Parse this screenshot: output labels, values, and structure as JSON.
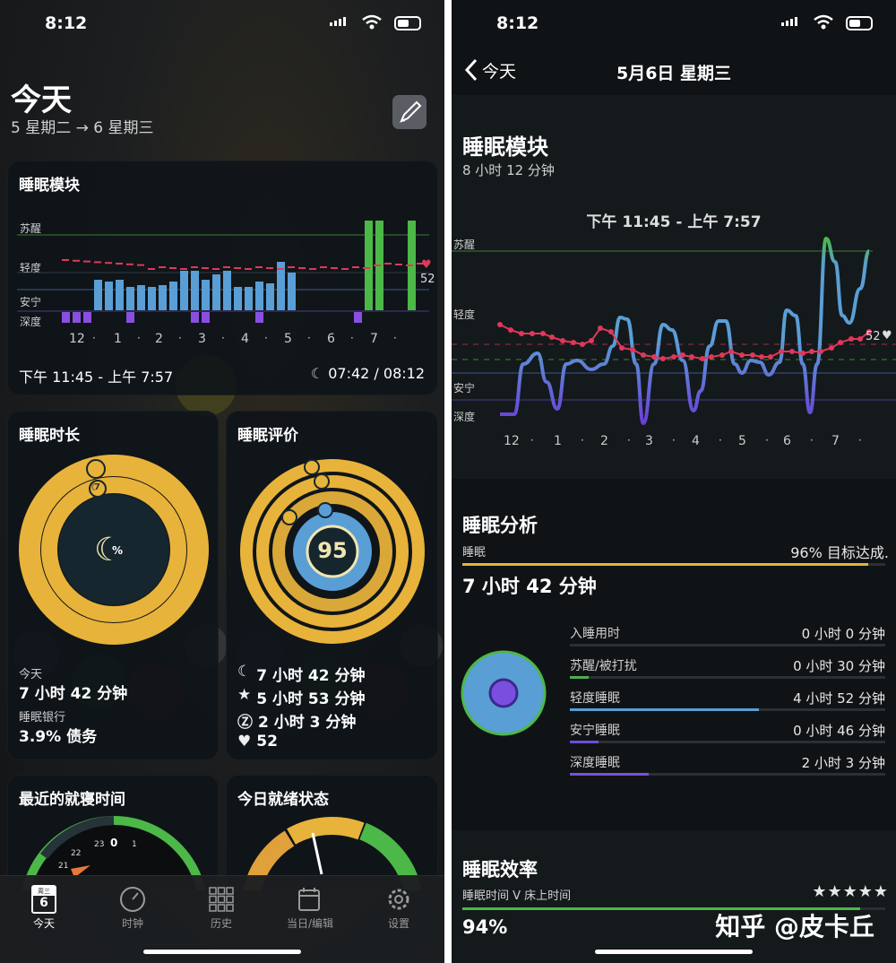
{
  "status": {
    "time": "8:12"
  },
  "left": {
    "title": "今天",
    "subtitle": "5 星期二 → 6 星期三",
    "sleep_module": {
      "title": "睡眠模块",
      "stage_labels": [
        "苏醒",
        "轻度",
        "安宁",
        "深度"
      ],
      "hour_labels": [
        "12",
        "1",
        "2",
        "3",
        "4",
        "5",
        "6",
        "7"
      ],
      "heart_value": "52",
      "time_range": "下午 11:45 - 上午 7:57",
      "duration_ratio": "07:42 / 08:12"
    },
    "duration_card": {
      "title": "睡眠时长",
      "ring_badge": "7",
      "center_label": "%",
      "today_label": "今天",
      "today_value": "7 小时 42 分钟",
      "bank_label": "睡眠银行",
      "bank_value": "3.9% 债务"
    },
    "rating_card": {
      "title": "睡眠评价",
      "score": "95",
      "rows": [
        "7 小时 42 分钟",
        "5 小时 53 分钟",
        "2 小时 3 分钟",
        "52"
      ]
    },
    "bedtime_card": {
      "title": "最近的就寝时间",
      "dial_numbers": [
        "23",
        "0",
        "1",
        "22",
        "21"
      ]
    },
    "readiness_card": {
      "title": "今日就绪状态"
    },
    "tabs": [
      {
        "label": "今天",
        "badge_top": "周三",
        "badge_num": "6"
      },
      {
        "label": "时钟"
      },
      {
        "label": "历史"
      },
      {
        "label": "当日/编辑"
      },
      {
        "label": "设置"
      }
    ]
  },
  "right": {
    "nav": {
      "back_label": "今天",
      "title": "5月6日 星期三"
    },
    "sleep_module": {
      "title": "睡眠模块",
      "subtitle": "8 小时 12 分钟",
      "chart_title": "下午 11:45 - 上午 7:57",
      "stage_labels": [
        "苏醒",
        "轻度",
        "安宁",
        "深度"
      ],
      "hour_labels": [
        "12",
        "1",
        "2",
        "3",
        "4",
        "5",
        "6",
        "7"
      ],
      "heart_value": "52"
    },
    "analysis": {
      "title": "睡眠分析",
      "label": "睡眠",
      "goal_text": "96% 目标达成.",
      "goal_fraction": 0.96,
      "total": "7 小时 42 分钟",
      "rows": [
        {
          "label": "入睡用时",
          "value": "0 小时 0 分钟",
          "fraction": 0.0,
          "color": "#4caf50"
        },
        {
          "label": "苏醒/被打扰",
          "value": "0 小时 30 分钟",
          "fraction": 0.06,
          "color": "#4caf50"
        },
        {
          "label": "轻度睡眠",
          "value": "4 小时 52 分钟",
          "fraction": 0.6,
          "color": "#5a9ed6"
        },
        {
          "label": "安宁睡眠",
          "value": "0 小时 46 分钟",
          "fraction": 0.09,
          "color": "#6a4fd8"
        },
        {
          "label": "深度睡眠",
          "value": "2 小时 3 分钟",
          "fraction": 0.25,
          "color": "#7a4fe0"
        }
      ]
    },
    "efficiency": {
      "title": "睡眠效率",
      "sublabel": "睡眠时间 V 床上时间",
      "stars": "★★★★★",
      "value": "94%",
      "fraction": 0.94
    },
    "watermark": "知乎 @皮卡丘"
  },
  "colors": {
    "yellow": "#e8b33a",
    "green": "#4cb848",
    "blue": "#5a9ed6",
    "purple": "#8a4fe0",
    "red": "#e0385a"
  }
}
